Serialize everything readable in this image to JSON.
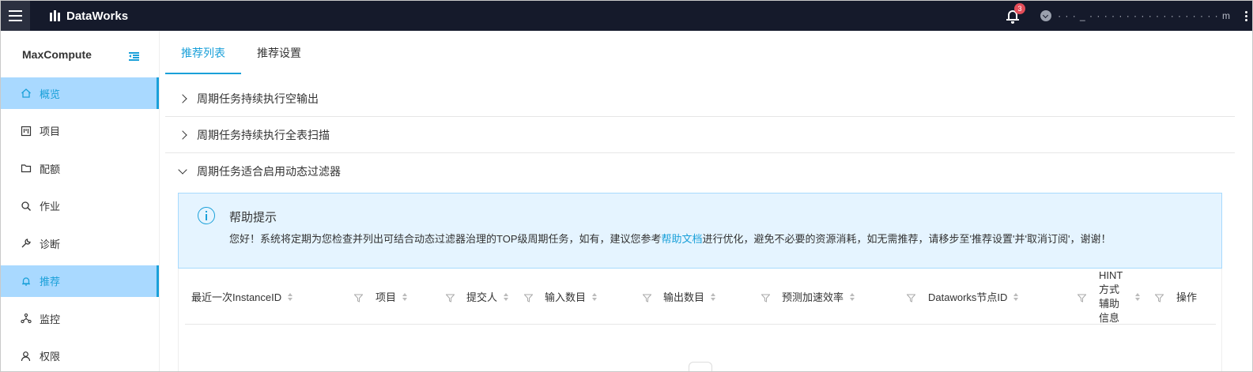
{
  "topbar": {
    "app_name": "DataWorks",
    "notification_count": "3",
    "user_name": "· · · _ · · · · · · · · · · · · · · · · · · m"
  },
  "sidebar": {
    "title": "MaxCompute",
    "items": [
      {
        "label": "概览",
        "icon": "home-icon",
        "active": true
      },
      {
        "label": "项目",
        "icon": "board-icon",
        "active": false
      },
      {
        "label": "配额",
        "icon": "folder-icon",
        "active": false
      },
      {
        "label": "作业",
        "icon": "search-icon",
        "active": false
      },
      {
        "label": "诊断",
        "icon": "wrench-icon",
        "active": false
      },
      {
        "label": "推荐",
        "icon": "bell-icon",
        "active": true
      },
      {
        "label": "监控",
        "icon": "network-icon",
        "active": false
      },
      {
        "label": "权限",
        "icon": "user-icon",
        "active": false
      }
    ]
  },
  "tabs": [
    {
      "label": "推荐列表",
      "active": true
    },
    {
      "label": "推荐设置",
      "active": false
    }
  ],
  "panels": [
    {
      "label": "周期任务持续执行空输出",
      "expanded": false
    },
    {
      "label": "周期任务持续执行全表扫描",
      "expanded": false
    },
    {
      "label": "周期任务适合启用动态过滤器",
      "expanded": true
    }
  ],
  "help": {
    "title": "帮助提示",
    "text_before": "您好！系统将定期为您检查并列出可结合动态过滤器治理的TOP级周期任务，如有，建议您参考",
    "link": "帮助文档",
    "text_after": "进行优化，避免不必要的资源消耗，如无需推荐，请移步至'推荐设置'并'取消订阅'，谢谢！"
  },
  "table": {
    "columns": [
      {
        "label": "最近一次InstanceID",
        "sortable": true,
        "filter": true
      },
      {
        "label": "项目",
        "sortable": true,
        "filter": true
      },
      {
        "label": "提交人",
        "sortable": true,
        "filter": true
      },
      {
        "label": "输入数目",
        "sortable": true,
        "filter": true
      },
      {
        "label": "输出数目",
        "sortable": true,
        "filter": true
      },
      {
        "label": "预测加速效率",
        "sortable": true,
        "filter": true
      },
      {
        "label": "Dataworks节点ID",
        "sortable": true,
        "filter": true
      },
      {
        "label": "HINT方式辅助信息",
        "sortable": true,
        "filter": true
      },
      {
        "label": "操作",
        "sortable": false,
        "filter": false
      }
    ]
  },
  "colors": {
    "accent": "#1aa0d9",
    "topbar_bg": "#151a2b",
    "active_item_bg": "#a9d9ff",
    "help_bg": "#e5f4ff",
    "badge": "#e34d59"
  }
}
